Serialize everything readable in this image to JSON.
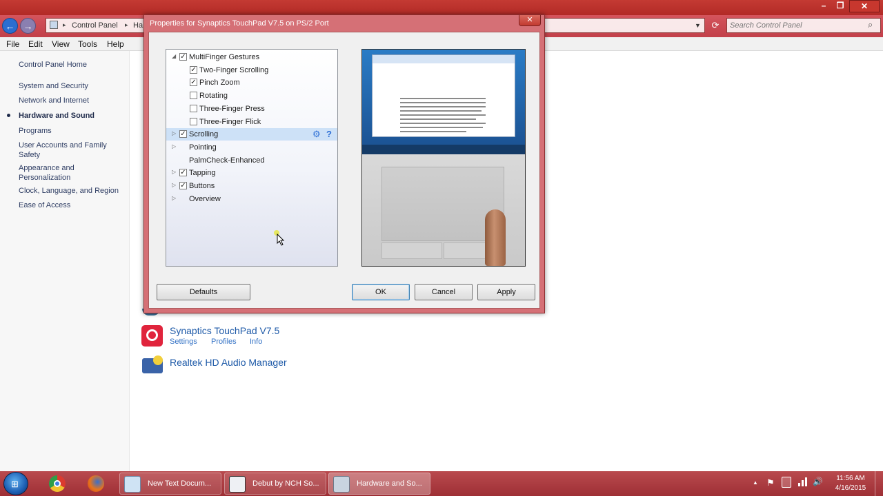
{
  "window": {
    "title_buttons": {
      "minimize": "–",
      "restore": "❐",
      "close": "✕"
    }
  },
  "address": {
    "back_glyph": "←",
    "forward_glyph": "→",
    "crumbs": [
      "Control Panel",
      "Ha"
    ],
    "search_placeholder": "Search Control Panel"
  },
  "menu": [
    "File",
    "Edit",
    "View",
    "Tools",
    "Help"
  ],
  "sidebar": {
    "home": "Control Panel Home",
    "items": [
      {
        "label": "System and Security",
        "current": false
      },
      {
        "label": "Network and Internet",
        "current": false
      },
      {
        "label": "Hardware and Sound",
        "current": true
      },
      {
        "label": "Programs",
        "current": false
      },
      {
        "label": "User Accounts and Family Safety",
        "current": false
      },
      {
        "label": "Appearance and Personalization",
        "current": false
      },
      {
        "label": "Clock, Language, and Region",
        "current": false
      },
      {
        "label": "Ease of Access",
        "current": false
      }
    ]
  },
  "main": {
    "synaptics": {
      "title": "Synaptics TouchPad V7.5",
      "links": [
        "Settings",
        "Profiles",
        "Info"
      ]
    },
    "realtek": {
      "title": "Realtek HD Audio Manager"
    }
  },
  "dialog": {
    "title": "Properties for Synaptics TouchPad V7.5 on PS/2 Port",
    "close_glyph": "✕",
    "tree": [
      {
        "label": "MultiFinger Gestures",
        "checked": true,
        "indent": 0,
        "expander": "◢"
      },
      {
        "label": "Two-Finger Scrolling",
        "checked": true,
        "indent": 1
      },
      {
        "label": "Pinch Zoom",
        "checked": true,
        "indent": 1
      },
      {
        "label": "Rotating",
        "checked": false,
        "indent": 1
      },
      {
        "label": "Three-Finger Press",
        "checked": false,
        "indent": 1
      },
      {
        "label": "Three-Finger Flick",
        "checked": false,
        "indent": 1
      },
      {
        "label": "Scrolling",
        "checked": true,
        "indent": 0,
        "expander": "▷",
        "selected": true
      },
      {
        "label": "Pointing",
        "indent": 0,
        "expander": "▷"
      },
      {
        "label": "PalmCheck-Enhanced",
        "indent": 0
      },
      {
        "label": "Tapping",
        "checked": true,
        "indent": 0,
        "expander": "▷"
      },
      {
        "label": "Buttons",
        "checked": true,
        "indent": 0,
        "expander": "▷"
      },
      {
        "label": "Overview",
        "indent": 0,
        "expander": "▷"
      }
    ],
    "row_icons": {
      "settings": "⚙",
      "help": "?"
    },
    "buttons": {
      "defaults": "Defaults",
      "ok": "OK",
      "cancel": "Cancel",
      "apply": "Apply"
    }
  },
  "taskbar": {
    "buttons": [
      "New Text Docum...",
      "Debut by NCH So...",
      "Hardware and So..."
    ],
    "tray": {
      "up": "▲",
      "flag": "⚑",
      "volume": "🔊"
    },
    "time": "11:56 AM",
    "date": "4/16/2015"
  }
}
